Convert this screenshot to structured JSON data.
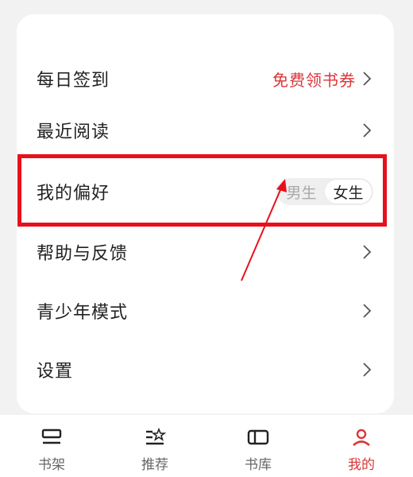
{
  "colors": {
    "accent": "#d9373a",
    "highlight_box": "#e8101b",
    "text_primary": "#222222",
    "text_muted": "#aaaaaa"
  },
  "menu": {
    "checkin": {
      "label": "每日签到",
      "promo": "免费领书券",
      "icon": "chevron-right-icon"
    },
    "recent": {
      "label": "最近阅读",
      "icon": "chevron-right-icon"
    },
    "preference": {
      "label": "我的偏好",
      "options": [
        "男生",
        "女生"
      ],
      "selected": "女生"
    },
    "feedback": {
      "label": "帮助与反馈",
      "icon": "chevron-right-icon"
    },
    "teen": {
      "label": "青少年模式",
      "icon": "chevron-right-icon"
    },
    "settings": {
      "label": "设置",
      "icon": "chevron-right-icon"
    }
  },
  "tabs": [
    {
      "label": "书架",
      "icon": "bookshelf-icon"
    },
    {
      "label": "推荐",
      "icon": "recommend-icon"
    },
    {
      "label": "书库",
      "icon": "library-icon"
    },
    {
      "label": "我的",
      "icon": "profile-icon",
      "active": true
    }
  ]
}
